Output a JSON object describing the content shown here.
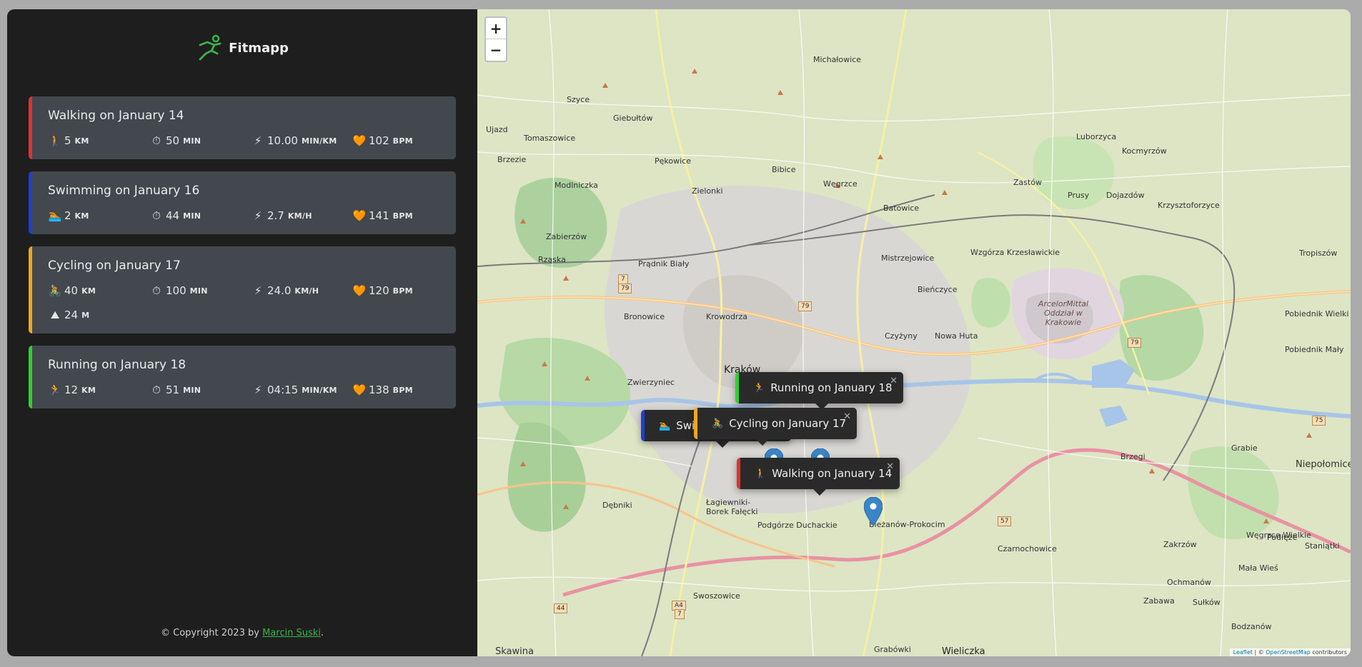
{
  "app": {
    "name": "Fitmapp"
  },
  "workouts": [
    {
      "title": "Walking on January 14",
      "color": "#e03131",
      "stats": [
        {
          "icon": "walking-icon",
          "glyph": "🚶",
          "value": "5",
          "unit": "km"
        },
        {
          "icon": "stopwatch-icon",
          "glyph": "⏱",
          "value": "50",
          "unit": "min"
        },
        {
          "icon": "lightning-icon",
          "glyph": "⚡",
          "value": "10.00",
          "unit": "min/km"
        },
        {
          "icon": "heart-icon",
          "glyph": "🧡",
          "value": "102",
          "unit": "bpm"
        }
      ]
    },
    {
      "title": "Swimming on January 16",
      "color": "#1c3fd6",
      "stats": [
        {
          "icon": "swimmer-icon",
          "glyph": "🏊",
          "value": "2",
          "unit": "km"
        },
        {
          "icon": "stopwatch-icon",
          "glyph": "⏱",
          "value": "44",
          "unit": "min"
        },
        {
          "icon": "lightning-icon",
          "glyph": "⚡",
          "value": "2.7",
          "unit": "km/h"
        },
        {
          "icon": "heart-icon",
          "glyph": "🧡",
          "value": "141",
          "unit": "bpm"
        }
      ]
    },
    {
      "title": "Cycling on January 17",
      "color": "#f0a81a",
      "stats": [
        {
          "icon": "cyclist-icon",
          "glyph": "🚴",
          "value": "40",
          "unit": "km"
        },
        {
          "icon": "stopwatch-icon",
          "glyph": "⏱",
          "value": "100",
          "unit": "min"
        },
        {
          "icon": "lightning-icon",
          "glyph": "⚡",
          "value": "24.0",
          "unit": "km/h"
        },
        {
          "icon": "heart-icon",
          "glyph": "🧡",
          "value": "120",
          "unit": "bpm"
        },
        {
          "icon": "mountain-icon",
          "glyph": "⛰",
          "value": "24",
          "unit": "m"
        }
      ]
    },
    {
      "title": "Running on January 18",
      "color": "#2fd12f",
      "stats": [
        {
          "icon": "runner-icon",
          "glyph": "🏃",
          "value": "12",
          "unit": "km"
        },
        {
          "icon": "stopwatch-icon",
          "glyph": "⏱",
          "value": "51",
          "unit": "min"
        },
        {
          "icon": "lightning-icon",
          "glyph": "⚡",
          "value": "04:15",
          "unit": "min/km"
        },
        {
          "icon": "heart-icon",
          "glyph": "🧡",
          "value": "138",
          "unit": "bpm"
        }
      ]
    }
  ],
  "footer": {
    "prefix": "© Copyright 2023 by",
    "author": "Marcin Suski",
    "suffix": "."
  },
  "map": {
    "zoom_in": "+",
    "zoom_out": "−",
    "popups": [
      {
        "label": "Running on January 18",
        "color": "#2fd12f",
        "glyph": "🏃"
      },
      {
        "label": "Swimming on January 16",
        "visible_text": "Swi",
        "color": "#1c3fd6",
        "glyph": "🏊"
      },
      {
        "label": "Cycling on January 17",
        "color": "#f0a81a",
        "glyph": "🚴"
      },
      {
        "label": "Walking on January 14",
        "color": "#e03131",
        "glyph": "🚶"
      }
    ],
    "labels": {
      "city": "Kraków",
      "arcelor": "ArcelorMittal Oddział w Krakowie",
      "places": [
        "Prądnik Biały",
        "Bronowice",
        "Krowodrza",
        "Zwierzyniec",
        "Dębniki",
        "Łagiewniki-Borek Fałęcki",
        "Podgórze Duchackie",
        "Bieżanów-Prokocim",
        "Czyżyny",
        "Nowa Huta",
        "Mistrzejowice",
        "Bieńczyce",
        "Wzgórza Krzesławickie",
        "Swoszowice",
        "Wieliczka",
        "Skawina",
        "Niepołomice",
        "Grabie",
        "Brzegi",
        "Czarnochowice",
        "Zielonki",
        "Bibice",
        "Węgrzce",
        "Batowice",
        "Modlniczka",
        "Tomaszowice",
        "Brzezie",
        "Rząska",
        "Zabierzów",
        "Ujazd",
        "Szyce",
        "Giebułtów",
        "Pękowice",
        "Michałowice",
        "Zastów",
        "Kocmyrzów",
        "Luborzyca",
        "Prusy",
        "Dojazdów",
        "Krzysztoforzyce",
        "Węgrzce Wielkie",
        "Zakrzów",
        "Podłęże",
        "Staniątki",
        "Ochmanów",
        "Zabawa",
        "Sułków",
        "Mała Wieś",
        "Bodzanów",
        "Grabówki",
        "Pobiednik Wielki",
        "Pobiednik Mały",
        "Tropiszów"
      ]
    },
    "roads": [
      "7",
      "79",
      "79",
      "79",
      "57",
      "44",
      "A4",
      "7",
      "75"
    ],
    "attribution": {
      "leaflet": "Leaflet",
      "sep": " | © ",
      "osm": "OpenStreetMap",
      "tail": " contributors"
    }
  }
}
